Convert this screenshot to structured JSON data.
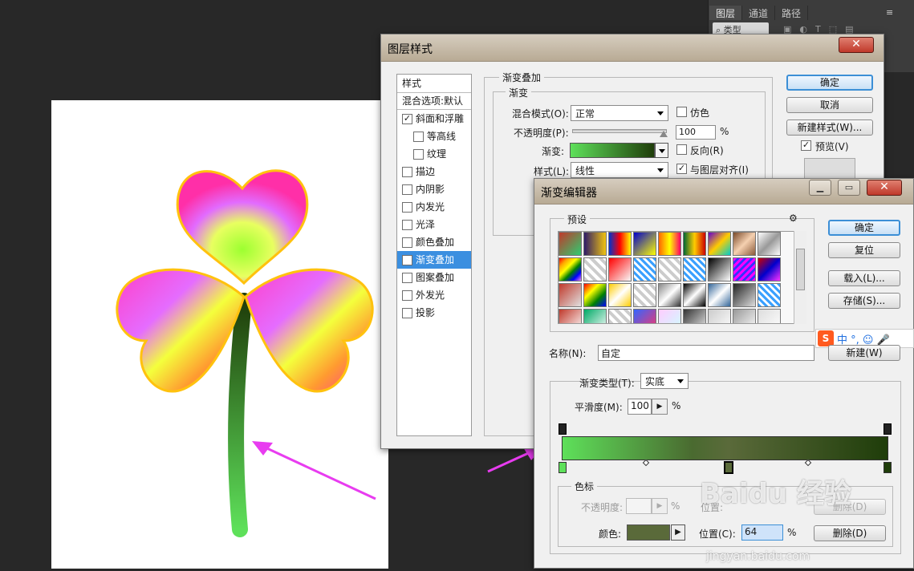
{
  "panel": {
    "tabs": [
      "图层",
      "通道",
      "路径"
    ],
    "menu": "≡",
    "search_label": "类型"
  },
  "layer_style": {
    "title": "图层样式",
    "left_items": [
      {
        "label": "样式",
        "check": null,
        "indent": false
      },
      {
        "label": "混合选项:默认",
        "check": null,
        "indent": false
      },
      {
        "label": "斜面和浮雕",
        "check": true,
        "indent": false
      },
      {
        "label": "等高线",
        "check": false,
        "indent": true
      },
      {
        "label": "纹理",
        "check": false,
        "indent": true
      },
      {
        "label": "描边",
        "check": false,
        "indent": false
      },
      {
        "label": "内阴影",
        "check": false,
        "indent": false
      },
      {
        "label": "内发光",
        "check": false,
        "indent": false
      },
      {
        "label": "光泽",
        "check": false,
        "indent": false
      },
      {
        "label": "颜色叠加",
        "check": false,
        "indent": false
      },
      {
        "label": "渐变叠加",
        "check": true,
        "indent": false
      },
      {
        "label": "图案叠加",
        "check": false,
        "indent": false
      },
      {
        "label": "外发光",
        "check": false,
        "indent": false
      },
      {
        "label": "投影",
        "check": false,
        "indent": false
      }
    ],
    "section_title": "渐变叠加",
    "subsection": "渐变",
    "blend_mode_label": "混合模式(O):",
    "blend_mode_value": "正常",
    "dither_label": "仿色",
    "opacity_label": "不透明度(P):",
    "opacity_value": "100",
    "percent": "%",
    "gradient_label": "渐变:",
    "reverse_label": "反向(R)",
    "style_label": "样式(L):",
    "style_value": "线性",
    "align_label": "与图层对齐(I)",
    "ok": "确定",
    "cancel": "取消",
    "new_style": "新建样式(W)...",
    "preview": "预览(V)"
  },
  "gradient_editor": {
    "title": "渐变编辑器",
    "presets_label": "预设",
    "gear": "⚙",
    "ok": "确定",
    "reset": "复位",
    "load": "载入(L)...",
    "save": "存储(S)...",
    "name_label": "名称(N):",
    "name_value": "自定",
    "new": "新建(W)",
    "type_label": "渐变类型(T):",
    "type_value": "实底",
    "smooth_label": "平滑度(M):",
    "smooth_value": "100",
    "percent": "%",
    "stops_group": "色标",
    "opacity_label": "不透明度:",
    "location_label_faded": "位置:",
    "delete_faded": "删除(D)",
    "color_label": "颜色:",
    "location_label": "位置(C):",
    "location_value": "64",
    "delete": "删除(D)",
    "colors": {
      "stop_color": "#5a6a3a",
      "grad_start": "#5ee05a",
      "grad_end": "#1f3d0a"
    }
  },
  "ime": {
    "logo": "S",
    "text": "中 °, ☺ 🎤"
  },
  "watermark": {
    "brand": "Baidu 经验",
    "url": "jingyan.baidu.com"
  }
}
